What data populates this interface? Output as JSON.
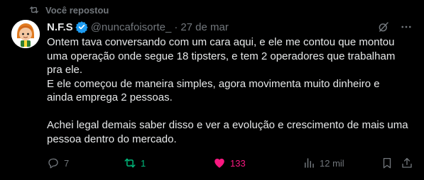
{
  "repost": {
    "label": "Você repostou",
    "icon": "repost-icon"
  },
  "author": {
    "name": "N.F.S",
    "handle": "@nuncafoisorte_",
    "separator": "·",
    "date": "27 de mar",
    "verified_color": "#1d9bf0"
  },
  "tweet": {
    "lines": [
      "Ontem tava conversando com um cara aqui, e ele me contou que montou",
      "uma operação onde segue 18 tipsters, e tem 2 operadores que trabalham",
      "pra ele.",
      "E ele começou de maneira simples, agora movimenta muito dinheiro e",
      "ainda emprega 2 pessoas.",
      "",
      "Achei legal demais saber disso e ver a evolução e crescimento de mais uma",
      "pessoa dentro do mercado."
    ]
  },
  "actions": {
    "replies": "7",
    "reposts": "1",
    "likes": "133",
    "views": "12 mil",
    "repost_color": "#00ba7c",
    "like_color": "#f91880"
  },
  "colors": {
    "background": "#000000",
    "text": "#e7e9ea",
    "muted": "#71767b"
  }
}
